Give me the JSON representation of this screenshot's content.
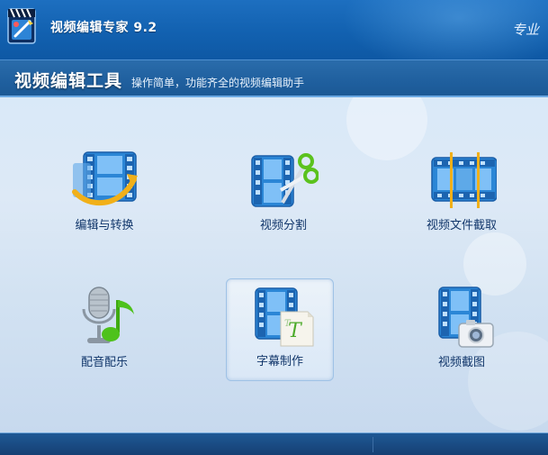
{
  "app": {
    "title": "视频编辑专家 9.2",
    "brand_mark": "专业"
  },
  "section": {
    "title": "视频编辑工具",
    "subtitle": "操作简单，功能齐全的视频编辑助手"
  },
  "tools": [
    {
      "label": "编辑与转换",
      "icon": "film-edit-convert-icon",
      "selected": false
    },
    {
      "label": "视频分割",
      "icon": "film-scissors-icon",
      "selected": false
    },
    {
      "label": "视频文件截取",
      "icon": "film-trim-icon",
      "selected": false
    },
    {
      "label": "配音配乐",
      "icon": "microphone-music-icon",
      "selected": false
    },
    {
      "label": "字幕制作",
      "icon": "film-subtitle-icon",
      "selected": true
    },
    {
      "label": "视频截图",
      "icon": "film-camera-icon",
      "selected": false
    }
  ],
  "colors": {
    "titlebar": "#1261b0",
    "header": "#1f5f9e",
    "label": "#12376b",
    "film_blue": "#2b86d6",
    "accent_green": "#4ec21c"
  }
}
